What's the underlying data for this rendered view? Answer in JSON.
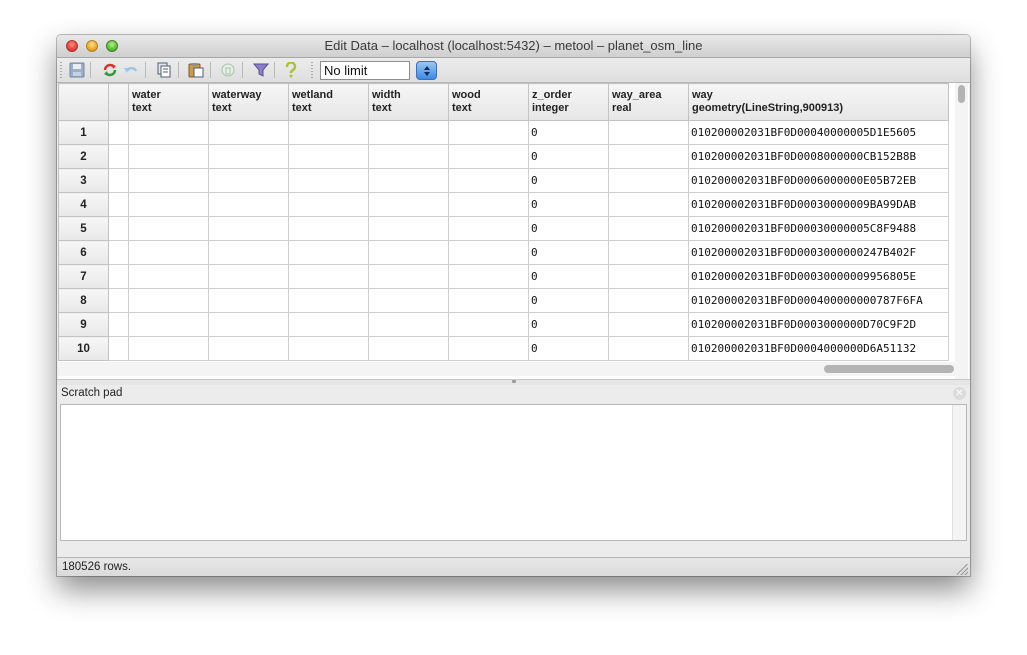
{
  "window": {
    "title": "Edit Data – localhost (localhost:5432) – metool – planet_osm_line"
  },
  "toolbar": {
    "icons": [
      "save-icon",
      "refresh-icon",
      "undo-icon",
      "copy-icon",
      "paste-icon",
      "delete-icon",
      "filter-icon",
      "help-icon"
    ],
    "limit_value": "No limit"
  },
  "grid": {
    "columns": [
      {
        "name": "water",
        "type": "text"
      },
      {
        "name": "waterway",
        "type": "text"
      },
      {
        "name": "wetland",
        "type": "text"
      },
      {
        "name": "width",
        "type": "text"
      },
      {
        "name": "wood",
        "type": "text"
      },
      {
        "name": "z_order",
        "type": "integer"
      },
      {
        "name": "way_area",
        "type": "real"
      },
      {
        "name": "way",
        "type": "geometry(LineString,900913)"
      }
    ],
    "rows": [
      {
        "num": "1",
        "z_order": "0",
        "way": "010200002031BF0D00040000005D1E5605"
      },
      {
        "num": "2",
        "z_order": "0",
        "way": "010200002031BF0D0008000000CB152B8B"
      },
      {
        "num": "3",
        "z_order": "0",
        "way": "010200002031BF0D0006000000E05B72EB"
      },
      {
        "num": "4",
        "z_order": "0",
        "way": "010200002031BF0D00030000009BA99DAB"
      },
      {
        "num": "5",
        "z_order": "0",
        "way": "010200002031BF0D00030000005C8F9488"
      },
      {
        "num": "6",
        "z_order": "0",
        "way": "010200002031BF0D0003000000247B402F"
      },
      {
        "num": "7",
        "z_order": "0",
        "way": "010200002031BF0D00030000009956805E"
      },
      {
        "num": "8",
        "z_order": "0",
        "way": "010200002031BF0D000400000000787F6FA"
      },
      {
        "num": "9",
        "z_order": "0",
        "way": "010200002031BF0D0003000000D70C9F2D"
      },
      {
        "num": "10",
        "z_order": "0",
        "way": "010200002031BF0D0004000000D6A51132"
      }
    ]
  },
  "scratch_pad": {
    "title": "Scratch pad",
    "content": ""
  },
  "status": {
    "text": "180526 rows."
  }
}
